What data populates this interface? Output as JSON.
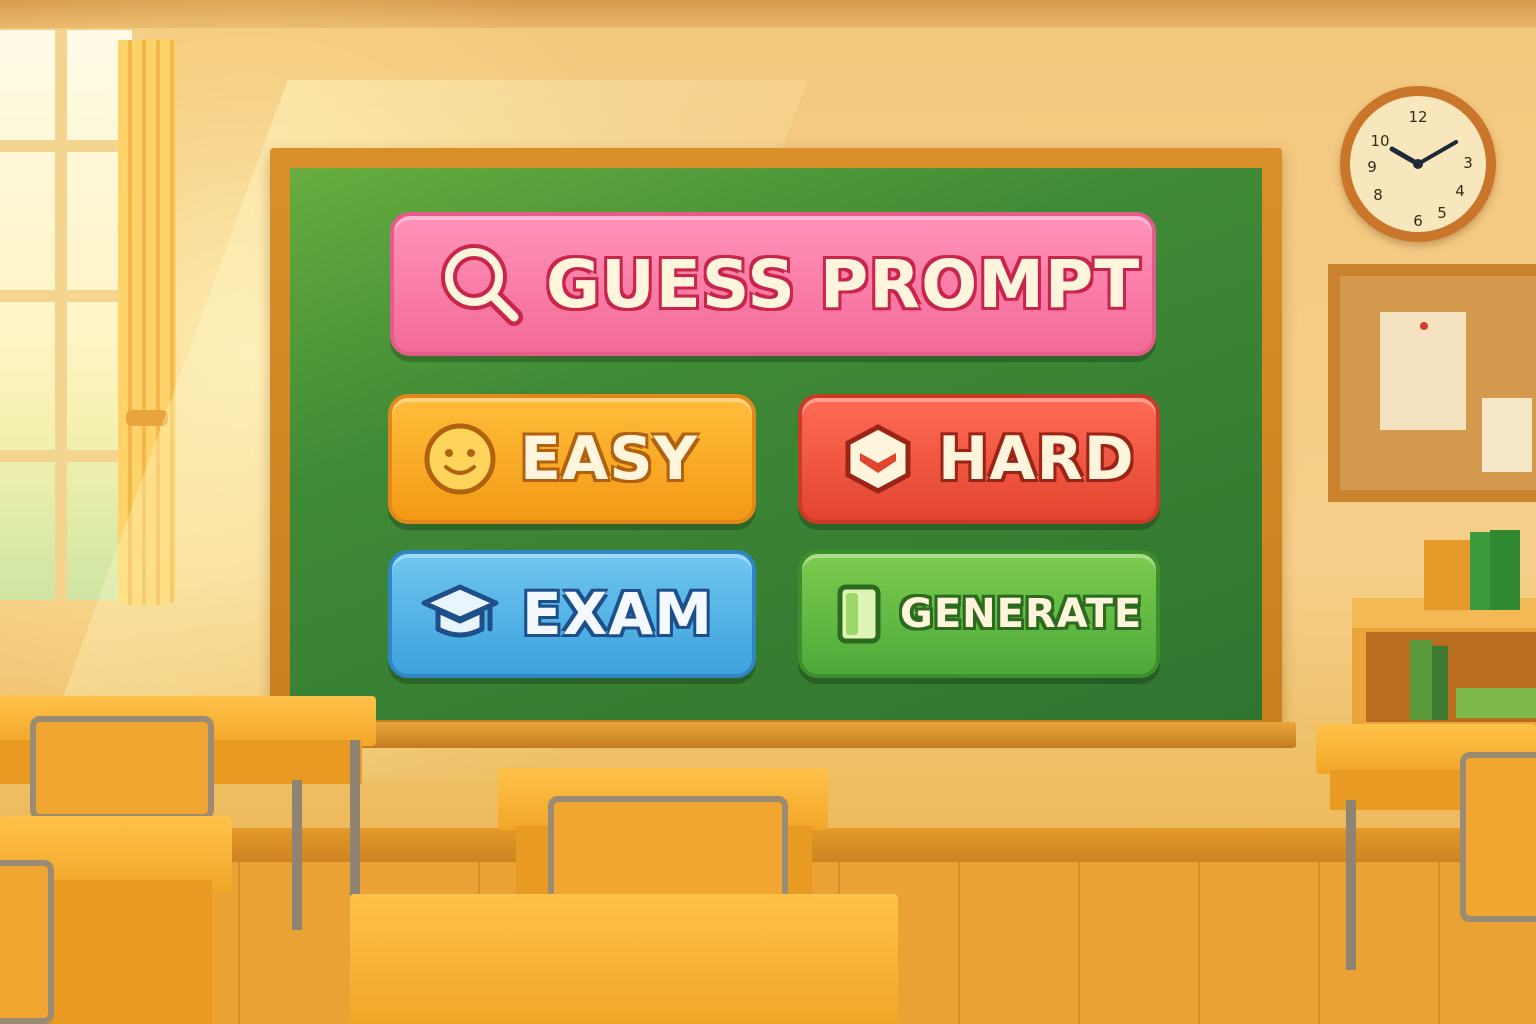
{
  "menu": {
    "guess_prompt": {
      "label": "GUESS PROMPT",
      "icon": "magnifier-icon"
    },
    "easy": {
      "label": "EASY",
      "icon": "smiley-icon"
    },
    "hard": {
      "label": "HARD",
      "icon": "cube-icon"
    },
    "exam": {
      "label": "EXAM",
      "icon": "graduation-cap-icon"
    },
    "generate": {
      "label": "GENERATE",
      "icon": "card-icon"
    }
  },
  "clock": {
    "numbers": [
      "12",
      "3",
      "4",
      "5",
      "6",
      "8",
      "9",
      "10"
    ],
    "hour_hand_angle_deg": -60,
    "minute_hand_angle_deg": 60
  },
  "colors": {
    "guess_prompt": "#f36a98",
    "easy": "#f39a16",
    "hard": "#e2452f",
    "exam": "#3ea2dc",
    "generate": "#4ea93a",
    "chalkboard": "#3f8a36"
  }
}
